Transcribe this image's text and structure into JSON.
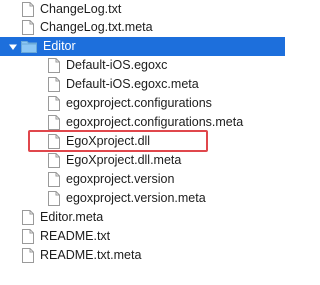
{
  "items": [
    {
      "label": "ChangeLog.txt"
    },
    {
      "label": "ChangeLog.txt.meta"
    },
    {
      "label": "Editor"
    },
    {
      "label": "Default-iOS.egoxc"
    },
    {
      "label": "Default-iOS.egoxc.meta"
    },
    {
      "label": "egoxproject.configurations"
    },
    {
      "label": "egoxproject.configurations.meta"
    },
    {
      "label": "EgoXproject.dll"
    },
    {
      "label": "EgoXproject.dll.meta"
    },
    {
      "label": "egoxproject.version"
    },
    {
      "label": "egoxproject.version.meta"
    },
    {
      "label": "Editor.meta"
    },
    {
      "label": "README.txt"
    },
    {
      "label": "README.txt.meta"
    }
  ],
  "colors": {
    "selection": "#1d6fdc",
    "highlight_border": "#e0474c",
    "folder": "#8cc7f5"
  },
  "icons": {
    "file": "document-icon",
    "folder": "folder-icon",
    "disclosure": "disclosure-triangle-expanded-icon"
  }
}
